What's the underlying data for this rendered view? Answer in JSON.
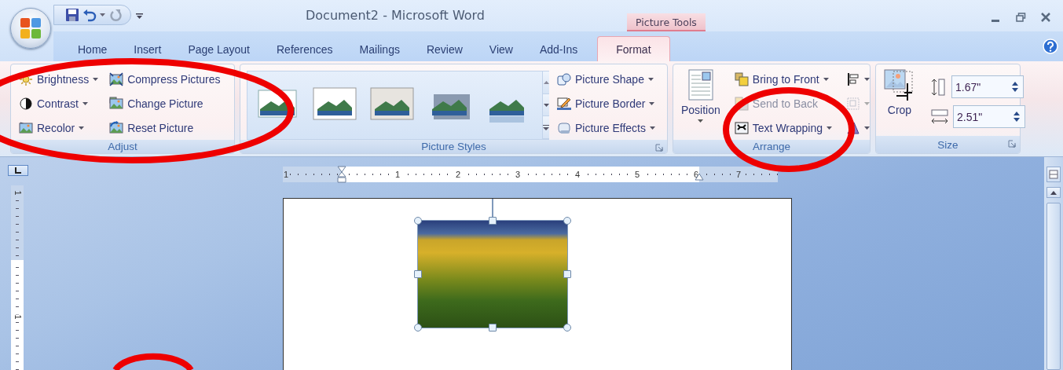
{
  "window": {
    "title": "Document2 - Microsoft Word",
    "context_label": "Picture Tools"
  },
  "tabs": [
    {
      "label": "Home",
      "selected": false,
      "contextual": false
    },
    {
      "label": "Insert",
      "selected": false,
      "contextual": false
    },
    {
      "label": "Page Layout",
      "selected": false,
      "contextual": false
    },
    {
      "label": "References",
      "selected": false,
      "contextual": false
    },
    {
      "label": "Mailings",
      "selected": false,
      "contextual": false
    },
    {
      "label": "Review",
      "selected": false,
      "contextual": false
    },
    {
      "label": "View",
      "selected": false,
      "contextual": false
    },
    {
      "label": "Add-Ins",
      "selected": false,
      "contextual": false
    },
    {
      "label": "Format",
      "selected": true,
      "contextual": true
    }
  ],
  "ribbon": {
    "groups": [
      {
        "kind": "commands",
        "title": "Adjust",
        "launcher": false,
        "columns": [
          [
            {
              "label": "Brightness",
              "dropdown": true,
              "disabled": false
            },
            {
              "label": "Contrast",
              "dropdown": true,
              "disabled": false
            },
            {
              "label": "Recolor",
              "dropdown": true,
              "disabled": false
            }
          ],
          [
            {
              "label": "Compress Pictures",
              "dropdown": false,
              "disabled": false
            },
            {
              "label": "Change Picture",
              "dropdown": false,
              "disabled": false
            },
            {
              "label": "Reset Picture",
              "dropdown": false,
              "disabled": false
            }
          ]
        ]
      },
      {
        "kind": "styles",
        "title": "Picture Styles",
        "launcher": true,
        "styles": [
          {
            "kind": "plain"
          },
          {
            "kind": "white-frame"
          },
          {
            "kind": "thick-frame"
          },
          {
            "kind": "shadow"
          },
          {
            "kind": "reflection"
          }
        ],
        "columns": [
          [
            {
              "label": "Picture Shape",
              "dropdown": true,
              "disabled": false
            },
            {
              "label": "Picture Border",
              "dropdown": true,
              "disabled": false
            },
            {
              "label": "Picture Effects",
              "dropdown": true,
              "disabled": false
            }
          ]
        ]
      },
      {
        "kind": "arrange",
        "title": "Arrange",
        "launcher": false,
        "large": {
          "label": "Position",
          "dropdown": true
        },
        "columns": [
          [
            {
              "label": "Bring to Front",
              "dropdown": true,
              "disabled": false
            },
            {
              "label": "Send to Back",
              "dropdown": false,
              "disabled": true
            },
            {
              "label": "Text Wrapping",
              "dropdown": true,
              "disabled": false
            }
          ],
          [
            {
              "dropdown": true,
              "disabled": false
            },
            {
              "dropdown": true,
              "disabled": true
            },
            {
              "dropdown": true,
              "disabled": false
            }
          ]
        ]
      },
      {
        "kind": "size",
        "title": "Size",
        "launcher": true,
        "large": {
          "label": "Crop",
          "dropdown": false
        },
        "fields": [
          {
            "value": "1.67\""
          },
          {
            "value": "2.51\""
          }
        ]
      }
    ]
  },
  "ruler": {
    "horizontal": [
      "1",
      "1",
      "2",
      "3",
      "4",
      "5",
      "6",
      "7"
    ],
    "vertical": [
      "1",
      "1"
    ]
  },
  "picture": {
    "selected": true
  }
}
